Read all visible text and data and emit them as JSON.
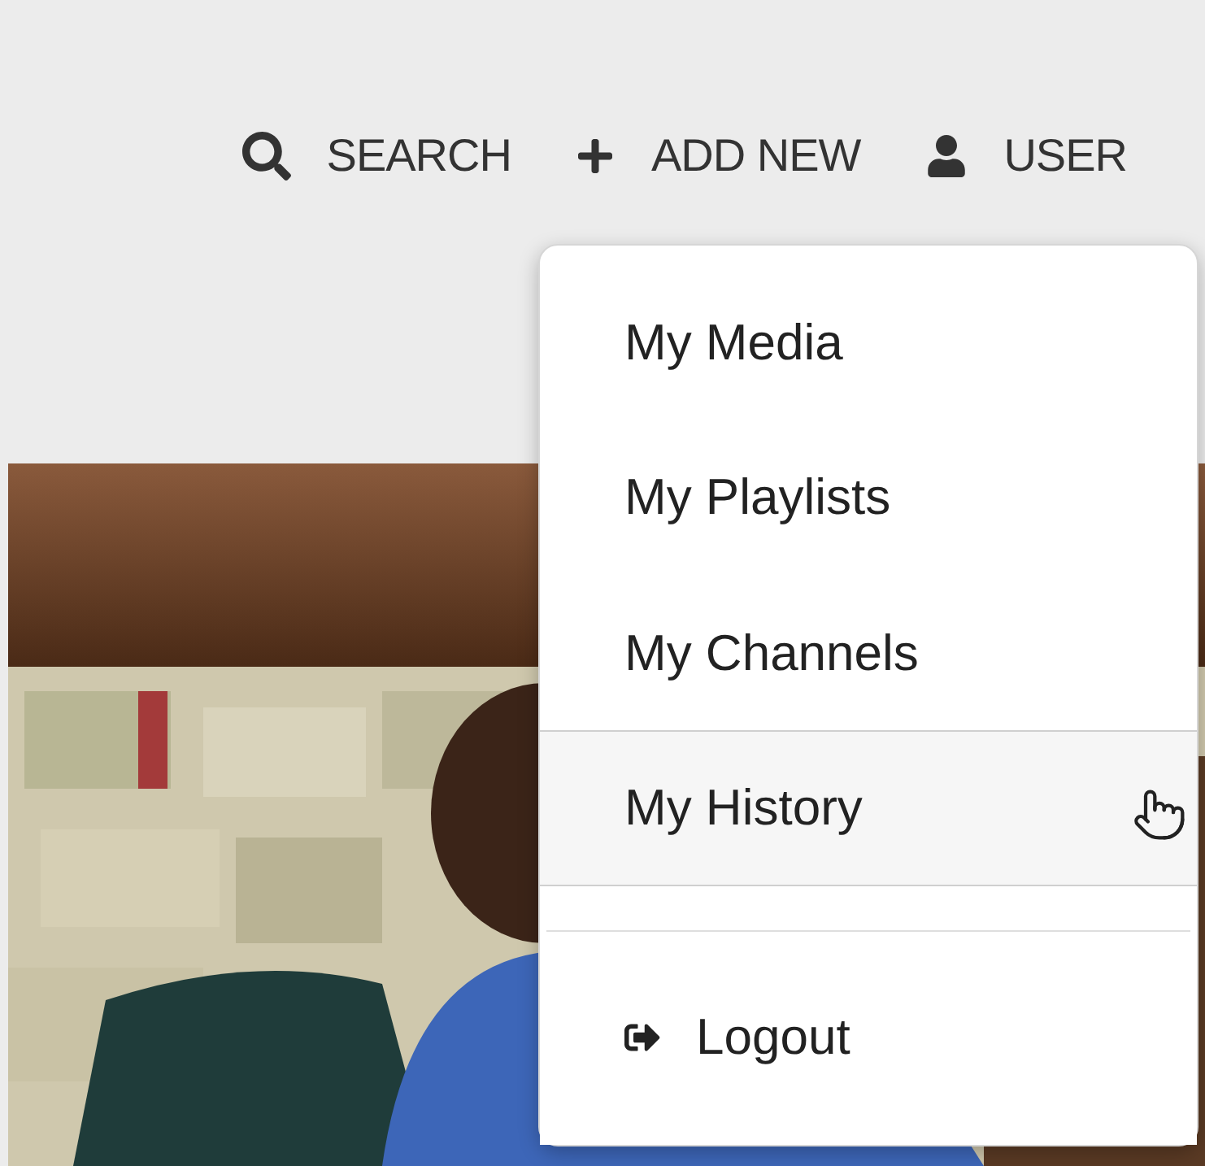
{
  "nav": [
    {
      "label": "SEARCH",
      "kind": "search"
    },
    {
      "label": "ADD NEW",
      "kind": "plus"
    },
    {
      "label": "USER",
      "kind": "user"
    }
  ],
  "user_menu": {
    "items": [
      {
        "kind": "link",
        "label": "My Media",
        "highlighted": false
      },
      {
        "kind": "link",
        "label": "My Playlists",
        "highlighted": false
      },
      {
        "kind": "link",
        "label": "My Channels",
        "highlighted": false
      },
      {
        "kind": "link",
        "label": "My History",
        "highlighted": true
      },
      {
        "kind": "divider"
      },
      {
        "kind": "logout",
        "label": "Logout",
        "highlighted": false
      }
    ]
  }
}
